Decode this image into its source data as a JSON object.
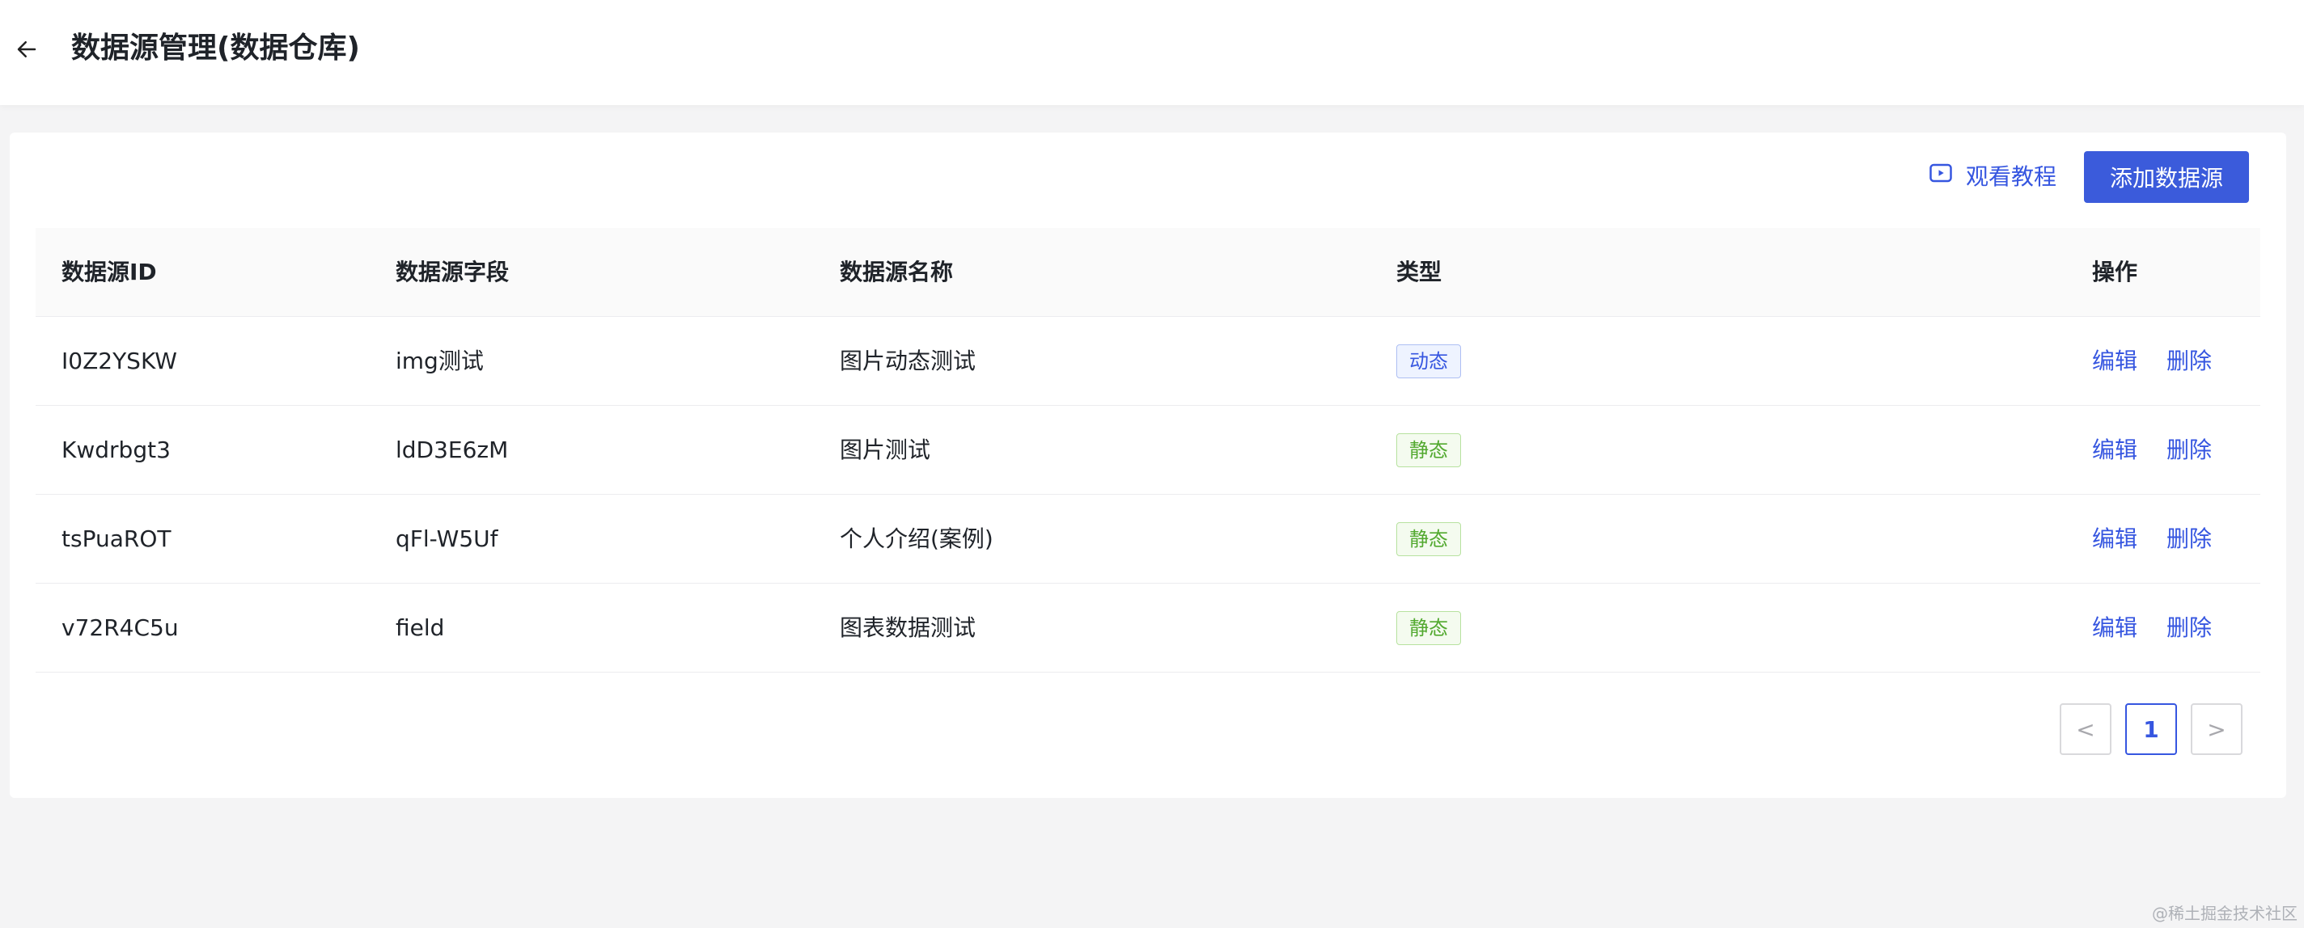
{
  "page": {
    "title": "数据源管理(数据仓库)"
  },
  "toolbar": {
    "tutorial_label": "观看教程",
    "add_label": "添加数据源"
  },
  "table": {
    "columns": [
      "数据源ID",
      "数据源字段",
      "数据源名称",
      "类型",
      "操作"
    ],
    "rows": [
      {
        "id": "I0Z2YSKW",
        "field": "img测试",
        "name": "图片动态测试",
        "type": "动态",
        "edit": "编辑",
        "delete": "删除"
      },
      {
        "id": "Kwdrbgt3",
        "field": "ldD3E6zM",
        "name": "图片测试",
        "type": "静态",
        "edit": "编辑",
        "delete": "删除"
      },
      {
        "id": "tsPuaROT",
        "field": "qFl-W5Uf",
        "name": "个人介绍(案例)",
        "type": "静态",
        "edit": "编辑",
        "delete": "删除"
      },
      {
        "id": "v72R4C5u",
        "field": "field",
        "name": "图表数据测试",
        "type": "静态",
        "edit": "编辑",
        "delete": "删除"
      }
    ]
  },
  "pagination": {
    "prev": "<",
    "current": "1",
    "next": ">"
  },
  "watermark": "@稀土掘金技术社区",
  "icons": {
    "back": "arrow-left-icon",
    "tutorial": "video-play-icon"
  },
  "colors": {
    "primary": "#3b5bdb",
    "link": "#3656e0",
    "static_tag": "#52a92f",
    "background": "#f4f4f5"
  }
}
